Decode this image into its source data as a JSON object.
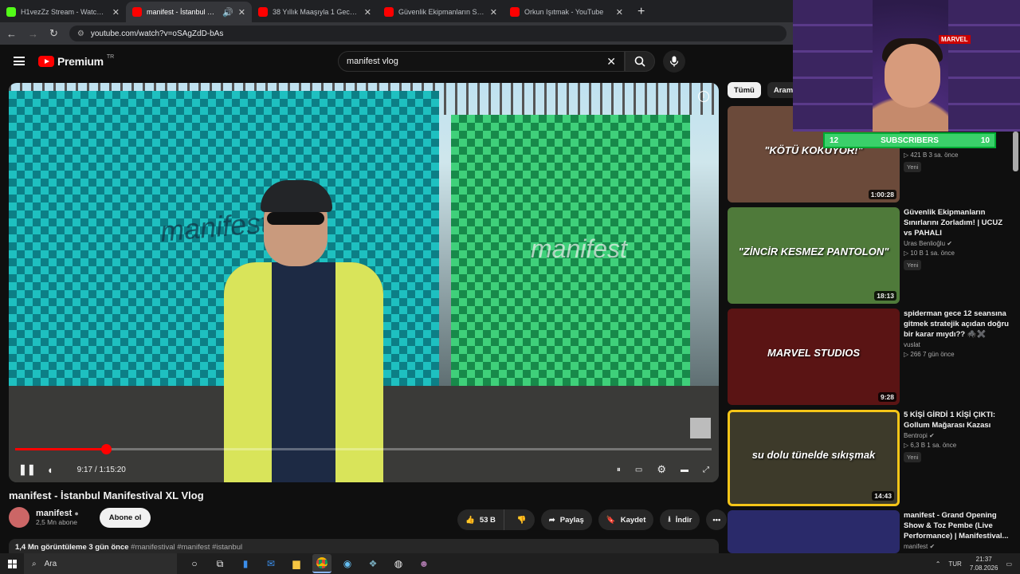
{
  "browser": {
    "tabs": [
      {
        "title": "H1vezZz Stream - Watch Live o",
        "fav_color": "#53fc18",
        "active": false
      },
      {
        "title": "manifest - İstanbul Manifes",
        "fav_color": "#ff0000",
        "active": true
      },
      {
        "title": "38 Yıllık Maaşıyla 1 Gece Lüks O",
        "fav_color": "#ff0000",
        "active": false
      },
      {
        "title": "Güvenlik Ekipmanların Sınırların",
        "fav_color": "#ff0000",
        "active": false
      },
      {
        "title": "Orkun Işıtmak - YouTube",
        "fav_color": "#ff0000",
        "active": false
      }
    ],
    "new_tab": "+",
    "url": "youtube.com/watch?v=oSAgZdD-bAs"
  },
  "youtube": {
    "logo_text": "Premium",
    "logo_region": "TR",
    "search_value": "manifest vlog",
    "clear_symbol": "✕"
  },
  "player": {
    "progress_fraction": 0.131,
    "time": "9:17 / 1:15:20",
    "info_symbol": "i",
    "screen_text_left": "manifest",
    "screen_text_right": "manifest"
  },
  "video": {
    "title": "manifest - İstanbul Manifestival XL Vlog",
    "channel": "manifest",
    "subscribers": "2,5 Mn abone",
    "subscribe_label": "Abone ol",
    "likes": "53 B",
    "share_label": "Paylaş",
    "save_label": "Kaydet",
    "download_label": "İndir",
    "more_label": "•••",
    "views_date": "1,4 Mn görüntüleme  3 gün önce",
    "hashtags": "#manifestival #manifest #istanbul"
  },
  "sidebar": {
    "chips": [
      "Tümü",
      "Arama"
    ],
    "recommendations": [
      {
        "title": "",
        "channel": "",
        "meta": "▷ 421 B   3 sa. önce",
        "badge": "Yeni",
        "duration": "1:00:28",
        "thumb_text": "\"KÖTÜ KOKUYOR!\"",
        "thumb_color": "#6b4a3a"
      },
      {
        "title": "Güvenlik Ekipmanların Sınırlarını Zorladım! | UCUZ vs PAHALI",
        "channel": "Uras Benlioğlu ✔",
        "meta": "▷ 10 B   1 sa. önce",
        "badge": "Yeni",
        "duration": "18:13",
        "thumb_text": "\"ZİNCİR KESMEZ PANTOLON\"",
        "thumb_color": "#4f7a3a"
      },
      {
        "title": "spiderman gece 12 seansına gitmek stratejik açıdan doğru bir karar mıydı?? 🕷️✖️",
        "channel": "vuslat",
        "meta": "▷ 266   7 gün önce",
        "badge": "",
        "duration": "9:28",
        "thumb_text": "MARVEL STUDIOS",
        "thumb_color": "#5a1414"
      },
      {
        "title": "5 KİŞİ GİRDİ 1 KİŞİ ÇIKTI: Gollum Mağarası Kazası",
        "channel": "Bentropi ✔",
        "meta": "▷ 6,3 B   1 sa. önce",
        "badge": "Yeni",
        "duration": "14:43",
        "thumb_text": "su dolu tünelde sıkışmak",
        "thumb_color": "#3d3a2a"
      },
      {
        "title": "manifest - Grand Opening Show & Toz Pembe (Live Performance) | Manifestival...",
        "channel": "manifest ✔",
        "meta": "",
        "badge": "",
        "duration": "",
        "thumb_text": "",
        "thumb_color": "#2a2a6a"
      }
    ]
  },
  "overlay": {
    "sub_left": "12",
    "sub_label": "SUBSCRIBERS",
    "sub_right": "10",
    "cam_sign": "MARVEL"
  },
  "taskbar": {
    "search_label": "Ara",
    "lang": "TUR",
    "time": "21:37",
    "date": "7.08.2026"
  }
}
